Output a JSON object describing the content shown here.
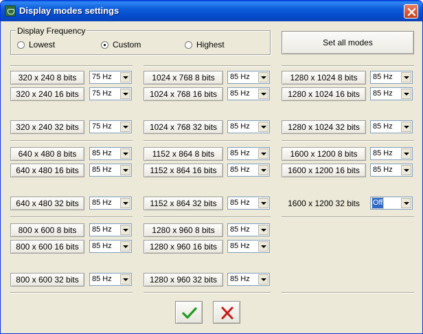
{
  "window": {
    "title": "Display modes settings"
  },
  "frequency": {
    "legend": "Display Frequency",
    "options": [
      "Lowest",
      "Custom",
      "Highest"
    ],
    "selected": "Custom"
  },
  "actions": {
    "set_all": "Set all modes"
  },
  "modes": [
    {
      "label": "320 x 240  8 bits",
      "value": "75 Hz"
    },
    {
      "label": "320 x 240  16 bits",
      "value": "75 Hz"
    },
    {
      "label": "320 x 240  32 bits",
      "value": "75 Hz"
    },
    {
      "label": "640 x 480  8 bits",
      "value": "85 Hz"
    },
    {
      "label": "640 x 480  16 bits",
      "value": "85 Hz"
    },
    {
      "label": "640 x 480  32 bits",
      "value": "85 Hz"
    },
    {
      "label": "800 x 600  8 bits",
      "value": "85 Hz"
    },
    {
      "label": "800 x 600  16 bits",
      "value": "85 Hz"
    },
    {
      "label": "800 x 600  32 bits",
      "value": "85 Hz"
    },
    {
      "label": "1024 x 768  8 bits",
      "value": "85 Hz"
    },
    {
      "label": "1024 x 768  16 bits",
      "value": "85 Hz"
    },
    {
      "label": "1024 x 768  32 bits",
      "value": "85 Hz"
    },
    {
      "label": "1152 x 864  8 bits",
      "value": "85 Hz"
    },
    {
      "label": "1152 x 864  16 bits",
      "value": "85 Hz"
    },
    {
      "label": "1152 x 864  32 bits",
      "value": "85 Hz"
    },
    {
      "label": "1280 x 960  8 bits",
      "value": "85 Hz"
    },
    {
      "label": "1280 x 960  16 bits",
      "value": "85 Hz"
    },
    {
      "label": "1280 x 960  32 bits",
      "value": "85 Hz"
    },
    {
      "label": "1280 x 1024  8 bits",
      "value": "85 Hz"
    },
    {
      "label": "1280 x 1024  16 bits",
      "value": "85 Hz"
    },
    {
      "label": "1280 x 1024  32 bits",
      "value": "85 Hz"
    },
    {
      "label": "1600 x 1200  8 bits",
      "value": "85 Hz"
    },
    {
      "label": "1600 x 1200  16 bits",
      "value": "85 Hz"
    },
    {
      "label": "1600 x 1200  32 bits",
      "value": "Off"
    }
  ],
  "icons": {
    "ok": "checkmark-icon",
    "cancel": "close-x-icon",
    "window_close": "close-icon"
  },
  "colors": {
    "ok": "#1f9c1f",
    "cancel": "#c81818",
    "selection": "#316ac5"
  }
}
